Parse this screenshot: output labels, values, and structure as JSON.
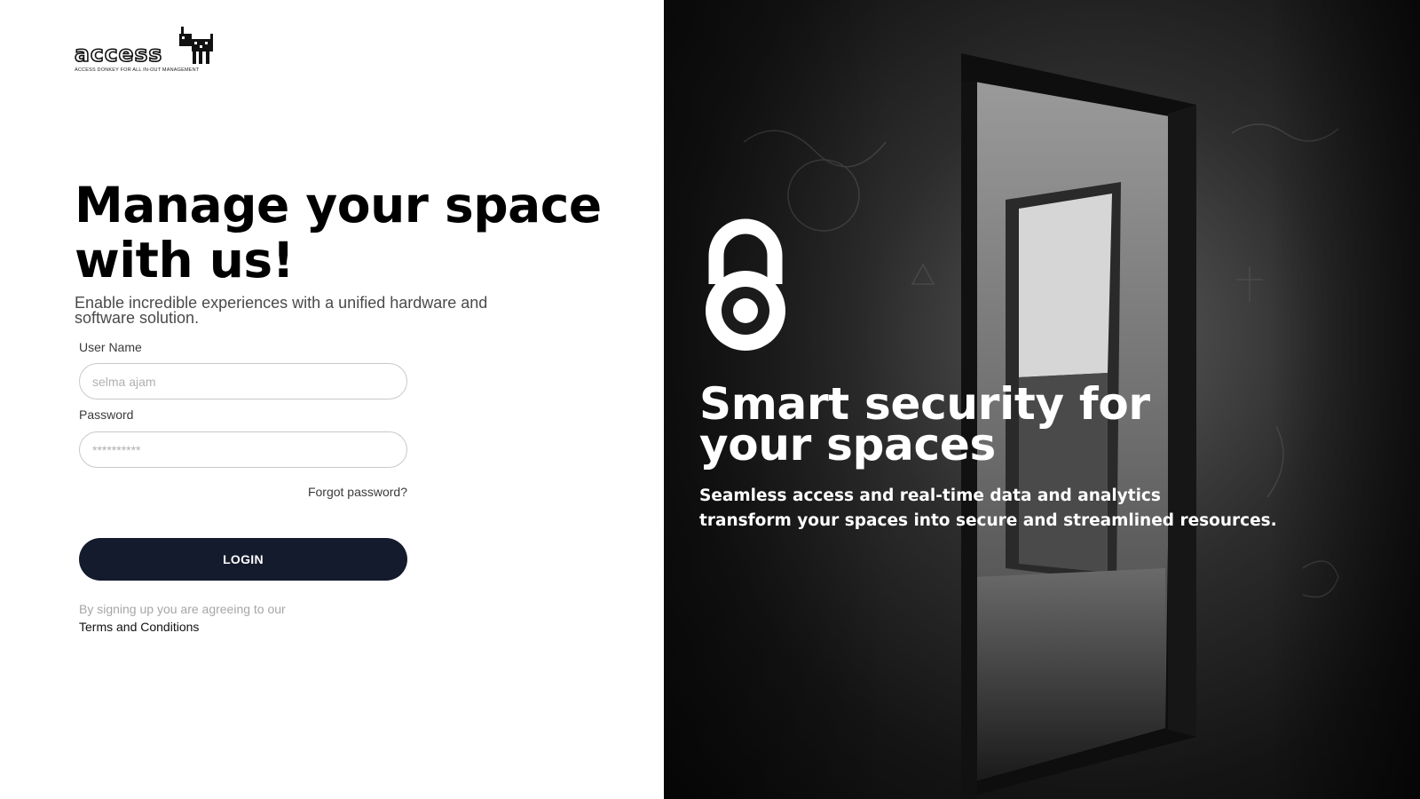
{
  "brand": {
    "name": "access",
    "tagline": "ACCESS DONKEY FOR ALL IN-OUT MANAGEMENT",
    "logo_icon": "donkey-icon"
  },
  "left": {
    "headline_line1": "Manage your space",
    "headline_line2": "with us!",
    "subtitle": "Enable incredible experiences with a unified hardware and software solution."
  },
  "form": {
    "username_label": "User Name",
    "username_placeholder": "selma ajam",
    "password_label": "Password",
    "password_placeholder": "**********",
    "forgot_label": "Forgot password?",
    "login_label": "LOGIN",
    "agree_text": "By signing up you are agreeing to our",
    "terms_label": "Terms and Conditions"
  },
  "right": {
    "icon": "lock-icon",
    "title_line1": "Smart security for",
    "title_line2": "your spaces",
    "subtitle_line1": "Seamless access and real-time data and analytics",
    "subtitle_line2": "transform your spaces into secure and streamlined resources."
  },
  "colors": {
    "primary_button": "#141b2d",
    "background": "#ffffff",
    "hero_text": "#ffffff"
  }
}
